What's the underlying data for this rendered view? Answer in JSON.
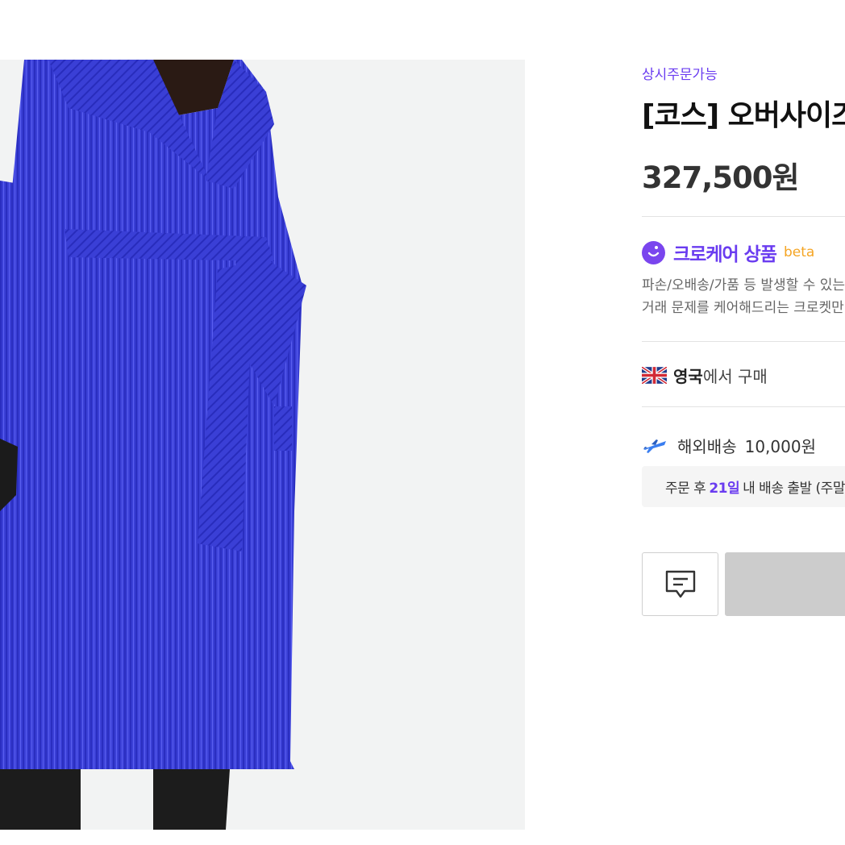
{
  "product": {
    "availability": "상시주문가능",
    "title": "[코스] 오버사이즈",
    "price": "327,500원",
    "image_icon": "product-photo-blue-corduroy-coat"
  },
  "care": {
    "title": "크로케어 상품",
    "beta": "beta",
    "desc_line1": "파손/오배송/가품 등 발생할 수 있는",
    "desc_line2": "거래 문제를 케어해드리는 크로켓만",
    "icon": "smile-icon"
  },
  "origin": {
    "country": "영국",
    "suffix": "에서 구매",
    "flag_icon": "uk-flag-icon"
  },
  "shipping": {
    "label": "해외배송",
    "fee": "10,000원",
    "note_prefix": "주문 후",
    "days": "21일",
    "note_suffix": "내 배송 출발 (주말",
    "icon": "airplane-icon"
  },
  "actions": {
    "chat_icon": "chat-icon",
    "buy_label": ""
  },
  "colors": {
    "accent": "#6a3cf0",
    "beta": "#f5a524",
    "coat": "#3b3fd9",
    "disabled_button": "#cccccc"
  }
}
